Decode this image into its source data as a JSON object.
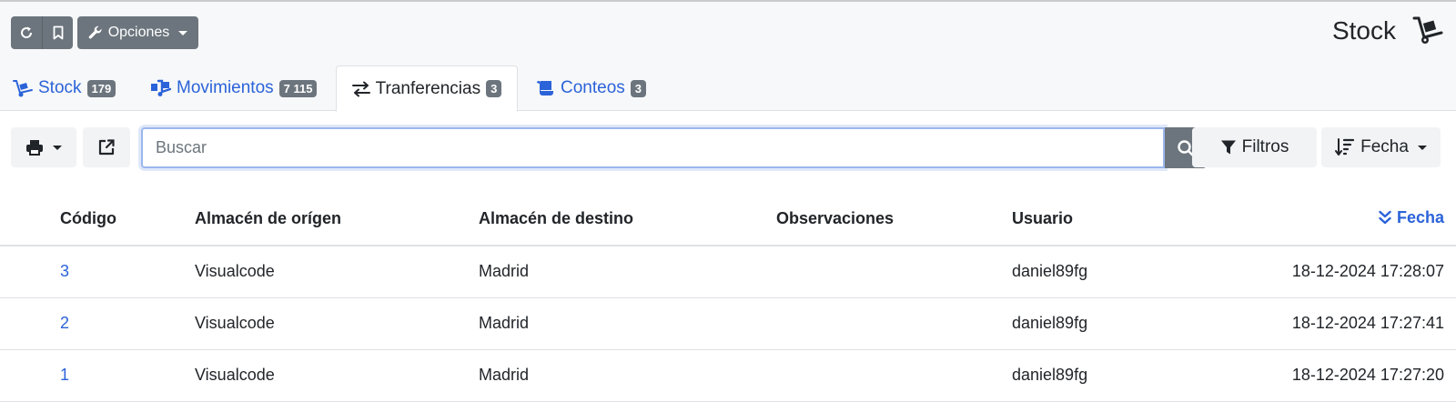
{
  "header": {
    "options_label": "Opciones",
    "title": "Stock"
  },
  "tabs": [
    {
      "label": "Stock",
      "badge": "179",
      "icon": "dolly-icon"
    },
    {
      "label": "Movimientos",
      "badge": "7 115",
      "icon": "truck-ramp-icon"
    },
    {
      "label": "Tranferencias",
      "badge": "3",
      "icon": "exchange-icon",
      "active": true
    },
    {
      "label": "Conteos",
      "badge": "3",
      "icon": "scroll-icon"
    }
  ],
  "toolbar": {
    "search_placeholder": "Buscar",
    "filters_label": "Filtros",
    "sort_label": "Fecha"
  },
  "table": {
    "columns": [
      "Código",
      "Almacén de orígen",
      "Almacén de destino",
      "Observaciones",
      "Usuario",
      "Fecha"
    ],
    "rows": [
      {
        "code": "3",
        "origin": "Visualcode",
        "destination": "Madrid",
        "notes": "",
        "user": "daniel89fg",
        "date": "18-12-2024 17:28:07"
      },
      {
        "code": "2",
        "origin": "Visualcode",
        "destination": "Madrid",
        "notes": "",
        "user": "daniel89fg",
        "date": "18-12-2024 17:27:41"
      },
      {
        "code": "1",
        "origin": "Visualcode",
        "destination": "Madrid",
        "notes": "",
        "user": "daniel89fg",
        "date": "18-12-2024 17:27:20"
      }
    ]
  },
  "colors": {
    "accent": "#2b63d9",
    "button_dark": "#6c757d"
  }
}
